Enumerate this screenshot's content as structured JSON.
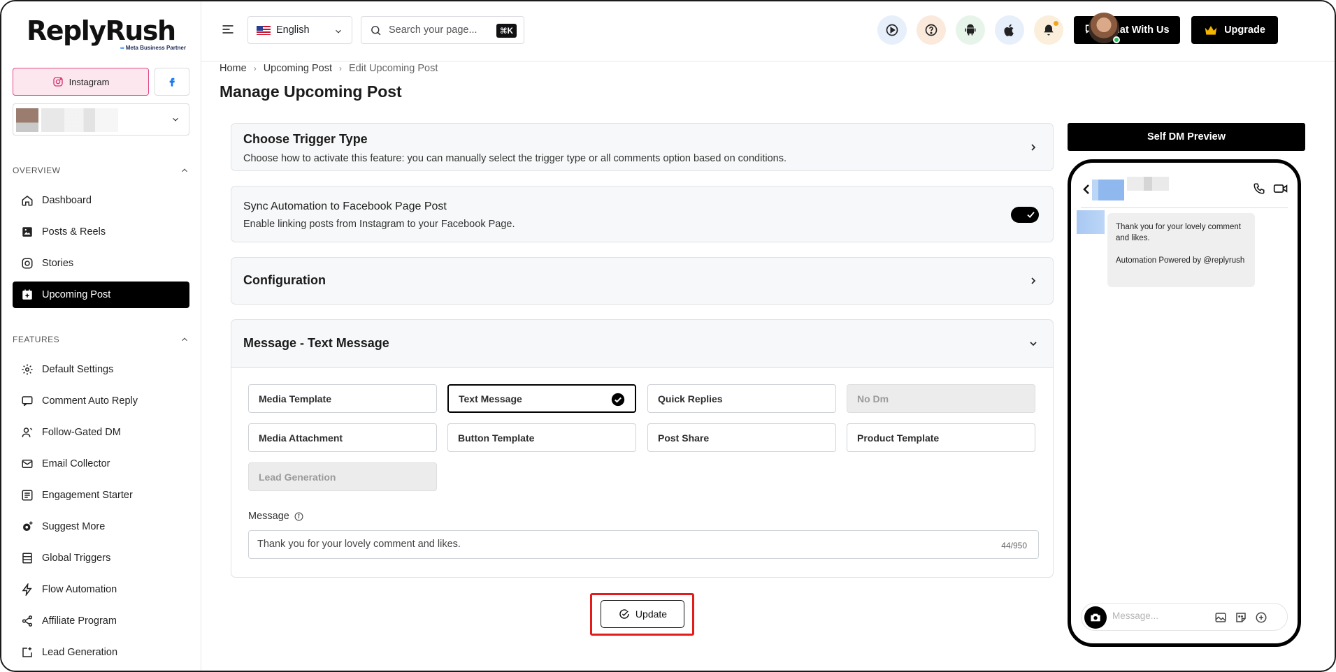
{
  "brand": {
    "name": "ReplyRush",
    "partner": "Meta Business Partner",
    "partner_mark": "∞"
  },
  "platforms": {
    "instagram_label": "Instagram"
  },
  "sidebar": {
    "overview_label": "OVERVIEW",
    "features_label": "FEATURES",
    "overview_items": [
      {
        "label": "Dashboard",
        "icon": "home-icon"
      },
      {
        "label": "Posts & Reels",
        "icon": "image-icon"
      },
      {
        "label": "Stories",
        "icon": "instagram-icon"
      },
      {
        "label": "Upcoming Post",
        "icon": "calendar-plus-icon",
        "active": true
      }
    ],
    "feature_items": [
      {
        "label": "Default Settings",
        "icon": "gear-icon"
      },
      {
        "label": "Comment Auto Reply",
        "icon": "comment-reply-icon"
      },
      {
        "label": "Follow-Gated DM",
        "icon": "user-gate-icon"
      },
      {
        "label": "Email Collector",
        "icon": "mail-icon"
      },
      {
        "label": "Engagement Starter",
        "icon": "engagement-icon"
      },
      {
        "label": "Suggest More",
        "icon": "gear-plus-icon"
      },
      {
        "label": "Global Triggers",
        "icon": "list-icon"
      },
      {
        "label": "Flow Automation",
        "icon": "bolt-icon"
      },
      {
        "label": "Affiliate Program",
        "icon": "share-icon"
      },
      {
        "label": "Lead Generation",
        "icon": "lead-icon"
      }
    ]
  },
  "topbar": {
    "language": "English",
    "search_placeholder": "Search your page...",
    "shortcut": "⌘K",
    "chat_label": "Chat With Us",
    "upgrade_label": "Upgrade",
    "icon_colors": {
      "play": "#e6effa",
      "help": "#fbe9dc",
      "android": "#e6f4ea",
      "apple": "#e6effa",
      "bell": "#fbefdc"
    }
  },
  "breadcrumb": [
    "Home",
    "Upcoming Post",
    "Edit Upcoming Post"
  ],
  "page_title": "Manage Upcoming Post",
  "trigger": {
    "title": "Choose Trigger Type",
    "desc": "Choose how to activate this feature: you can manually select the trigger type or all comments option based on conditions."
  },
  "sync": {
    "title": "Sync Automation to Facebook Page Post",
    "desc": "Enable linking posts from Instagram to your Facebook Page.",
    "enabled": true
  },
  "configuration": {
    "title": "Configuration"
  },
  "message_section": {
    "title": "Message - Text Message",
    "options": [
      {
        "label": "Media Template",
        "state": "normal"
      },
      {
        "label": "Text Message",
        "state": "selected"
      },
      {
        "label": "Quick Replies",
        "state": "normal"
      },
      {
        "label": "No Dm",
        "state": "disabled"
      },
      {
        "label": "Media Attachment",
        "state": "normal"
      },
      {
        "label": "Button Template",
        "state": "normal"
      },
      {
        "label": "Post Share",
        "state": "normal"
      },
      {
        "label": "Product Template",
        "state": "normal"
      },
      {
        "label": "Lead Generation",
        "state": "disabled"
      }
    ],
    "message_label": "Message",
    "message_value": "Thank you for your lovely comment and likes.",
    "char_count": "44/950"
  },
  "update_label": "Update",
  "preview": {
    "header": "Self DM Preview",
    "bubble_line1": "Thank you for your lovely comment and likes.",
    "bubble_line2": "Automation Powered by @replyrush",
    "input_placeholder": "Message..."
  }
}
